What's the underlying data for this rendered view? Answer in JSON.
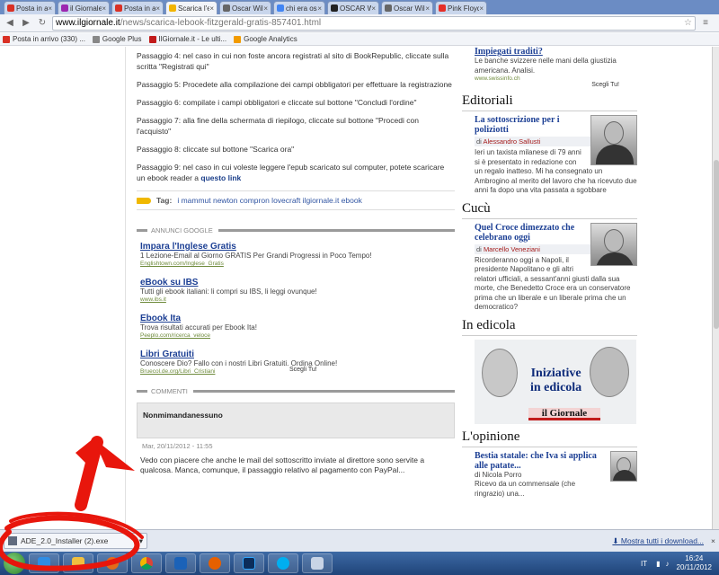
{
  "tabs": [
    {
      "label": "Posta in arriv",
      "color": "#d93025"
    },
    {
      "label": "il Giornale - t",
      "color": "#9c27b0"
    },
    {
      "label": "Posta in arriv",
      "color": "#d93025"
    },
    {
      "label": "Scarica l'ebo",
      "color": "#f2b400",
      "active": true
    },
    {
      "label": "Oscar Wilde",
      "color": "#666666"
    },
    {
      "label": "chi era oscar",
      "color": "#4285f4"
    },
    {
      "label": "OSCAR WILD",
      "color": "#222222"
    },
    {
      "label": "Oscar Wilde",
      "color": "#666666"
    },
    {
      "label": "Pink Floyd - ",
      "color": "#e52d27"
    }
  ],
  "address": {
    "host": "www.ilgiornale.it",
    "path": "/news/scarica-lebook-fitzgerald-gratis-857401.html"
  },
  "bookmarks": [
    {
      "label": "Posta in arrivo (330) ...",
      "color": "#d93025"
    },
    {
      "label": "Google Plus",
      "color": "#888888"
    },
    {
      "label": "IlGiornale.it - Le ulti...",
      "color": "#c21b1b"
    },
    {
      "label": "Google Analytics",
      "color": "#f29b00"
    }
  ],
  "steps": [
    {
      "text": "Passaggio 4: nel caso in cui non foste ancora registrati al sito di BookRepublic, cliccate sulla scritta \"Registrati qui\""
    },
    {
      "text": "Passaggio 5: Procedete alla compilazione dei campi obbligatori per effettuare la registrazione"
    },
    {
      "text": "Passaggio 6: compilate i campi obbligatori e cliccate sul bottone \"Concludi l'ordine\""
    },
    {
      "text": "Passaggio 7: alla fine della schermata di riepilogo, cliccate sul bottone \"Procedi con l'acquisto\""
    },
    {
      "text": "Passaggio 8: cliccate sul bottone \"Scarica ora\""
    },
    {
      "text": "Passaggio 9: nel caso in cui voleste leggere l'epub scaricato sul computer, potete scaricare un ebook reader a",
      "link": "questo link"
    }
  ],
  "tags": {
    "label": "Tag:",
    "values": "i mammut  newton  compron  lovecraft  ilgiornale.it  ebook"
  },
  "ads": {
    "heading": "ANNUNCI GOOGLE",
    "items": [
      {
        "title": "Impara l'Inglese Gratis",
        "desc": "1 Lezione-Email al Giorno GRATIS Per Grandi Progressi in Poco Tempo!",
        "url": "Englishtown.com/Inglese_Gratis"
      },
      {
        "title": "eBook su IBS",
        "desc": "Tutti gli ebook italiani: li compri su IBS, li leggi ovunque!",
        "url": "www.ibs.it"
      },
      {
        "title": "Ebook Ita",
        "desc": "Trova risultati accurati per Ebook Ita!",
        "url": "Peeplo.com/ricerca_veloce"
      },
      {
        "title": "Libri Gratuiti",
        "desc": "Conoscere Dio? Fallo con i nostri Libri Gratuiti. Ordina Online!",
        "url": "Bruecol.de.org/Libri_Cristiani"
      }
    ],
    "choices": "Scegli Tu!"
  },
  "comments": {
    "heading": "COMMENTI",
    "author": "Nonmimandanessuno",
    "date": "Mar, 20/11/2012 - 11:55",
    "text": "Vedo con piacere che anche le mail del sottoscritto inviate al direttore sono servite a qualcosa. Manca, comunque, il passaggio relativo al pagamento con PayPal..."
  },
  "sidebar": {
    "top": {
      "title": "Impiegati traditi?",
      "text": "Le banche svizzere nelle mani della giustizia americana. Analisi.",
      "url": "www.swissinfo.ch",
      "choices": "Scegli Tu!"
    },
    "editoriali": {
      "head": "Editoriali",
      "title": "La sottoscrizione per i poliziotti",
      "by": "di",
      "author": "Alessandro Sallusti",
      "text": "Ieri un taxista milanese di 79 anni si è presentato in redazione con un regalo inatteso. Mi ha consegnato un Ambrogino al merito del lavoro che ha ricevuto due anni fa dopo una vita passata a sgobbare"
    },
    "cuccu": {
      "head": "Cucù",
      "title": "Quel Croce dimezzato che celebrano oggi",
      "by": "di",
      "author": "Marcello Veneziani",
      "text": "Ricorderanno oggi a Napoli, il presidente Napolitano e gli altri relatori ufficiali, a sessant'anni giusti dalla sua morte, che Benedetto Croce era un conservatore prima che un liberale e un liberale prima che un democratico?"
    },
    "edicola": {
      "head": "In edicola",
      "line1": "Iniziative",
      "line2": "in edicola",
      "logo": "il Giornale"
    },
    "opinione": {
      "head": "L'opinione",
      "title": "Bestia statale: che Iva si applica alle patate...",
      "by": "di",
      "author": "Nicola Porro",
      "text": "Ricevo da un commensale (che ringrazio) una..."
    }
  },
  "download": {
    "file": "ADE_2.0_Installer (2).exe",
    "all": "Mostra tutti i download...",
    "close": "×"
  },
  "taskbar": {
    "lang": "IT",
    "time": "16:24",
    "date": "20/11/2012"
  },
  "colors": {
    "accent": "#1c3f94",
    "annotation": "#e8160c"
  }
}
